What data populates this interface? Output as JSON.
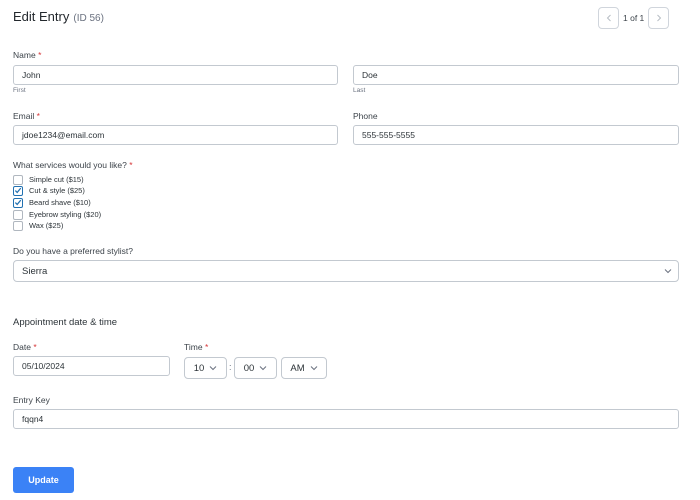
{
  "header": {
    "title": "Edit Entry",
    "entry_id": "(ID 56)",
    "pager_text": "1 of 1"
  },
  "name": {
    "label": "Name",
    "required_mark": "*",
    "first_value": "John",
    "first_sublabel": "First",
    "last_value": "Doe",
    "last_sublabel": "Last"
  },
  "email": {
    "label": "Email",
    "required_mark": "*",
    "value": "jdoe1234@email.com"
  },
  "phone": {
    "label": "Phone",
    "value": "555-555-5555"
  },
  "services": {
    "label": "What services would you like?",
    "required_mark": "*",
    "options": [
      {
        "label": "Simple cut ($15)",
        "checked": false
      },
      {
        "label": "Cut & style ($25)",
        "checked": true
      },
      {
        "label": "Beard shave ($10)",
        "checked": true
      },
      {
        "label": "Eyebrow styling ($20)",
        "checked": false
      },
      {
        "label": "Wax ($25)",
        "checked": false
      }
    ]
  },
  "stylist": {
    "label": "Do you have a preferred stylist?",
    "value": "Sierra"
  },
  "appointment": {
    "section_title": "Appointment date & time",
    "date_label": "Date",
    "date_required": "*",
    "date_value": "05/10/2024",
    "time_label": "Time",
    "time_required": "*",
    "hour": "10",
    "separator": ":",
    "minute": "00",
    "ampm": "AM"
  },
  "entry_key": {
    "label": "Entry Key",
    "value": "fqqn4"
  },
  "actions": {
    "update_label": "Update"
  },
  "colors": {
    "accent": "#3b82f6",
    "required": "#d63638",
    "checkbox": "#2271b1"
  },
  "icons": {
    "pager_prev": "chevron-left-icon",
    "pager_next": "chevron-right-icon",
    "select_arrow": "chevron-down-icon",
    "checkbox_mark": "checkmark-icon"
  }
}
